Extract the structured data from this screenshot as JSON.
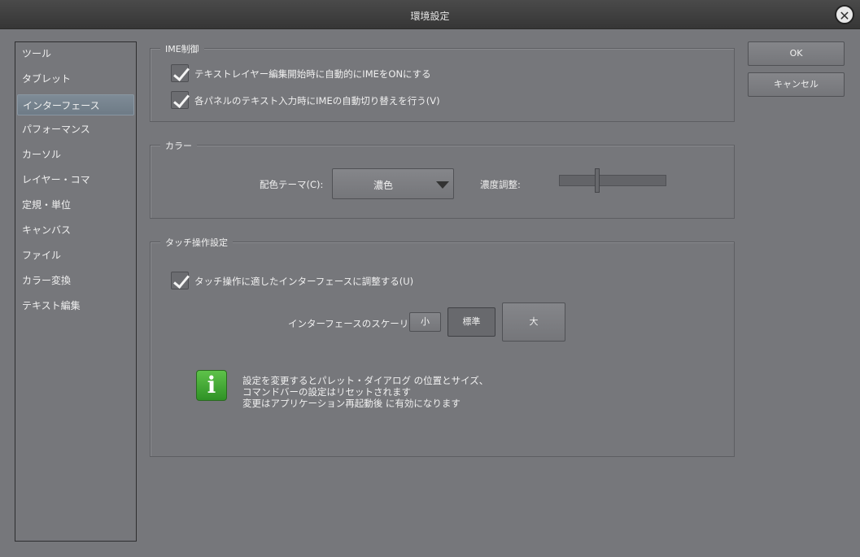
{
  "window": {
    "title": "環境設定",
    "close_icon": "close-icon"
  },
  "sidebar": {
    "items": [
      {
        "label": "ツール"
      },
      {
        "label": "タブレット"
      },
      {
        "label": "インターフェース",
        "selected": true
      },
      {
        "label": "パフォーマンス"
      },
      {
        "label": "カーソル"
      },
      {
        "label": "レイヤー・コマ"
      },
      {
        "label": "定規・単位"
      },
      {
        "label": "キャンバス"
      },
      {
        "label": "ファイル"
      },
      {
        "label": "カラー変換"
      },
      {
        "label": "テキスト編集"
      }
    ]
  },
  "ime": {
    "title": "IME制御",
    "options": [
      {
        "label": "テキストレイヤー編集開始時に自動的にIMEをONにする",
        "checked": true
      },
      {
        "label": "各パネルのテキスト入力時にIMEの自動切り替えを行う(V)",
        "checked": true
      }
    ]
  },
  "color": {
    "title": "カラー",
    "theme_label": "配色テーマ(C):",
    "theme_value": "濃色",
    "density_label": "濃度調整:",
    "density_value": 0.35
  },
  "touch": {
    "title": "タッチ操作設定",
    "option": {
      "label": "タッチ操作に適したインターフェースに調整する(U)",
      "checked": true
    },
    "scaling_label": "インターフェースのスケーリング:",
    "scaling_options": [
      "小",
      "標準",
      "大"
    ],
    "scaling_selected": "標準",
    "info_lines": [
      "設定を変更するとパレット・ダイアログ の位置とサイズ、",
      "コマンドバーの設定はリセットされます",
      "変更はアプリケーション再起動後 に有効になります"
    ]
  },
  "buttons": {
    "ok": "OK",
    "cancel": "キャンセル"
  }
}
